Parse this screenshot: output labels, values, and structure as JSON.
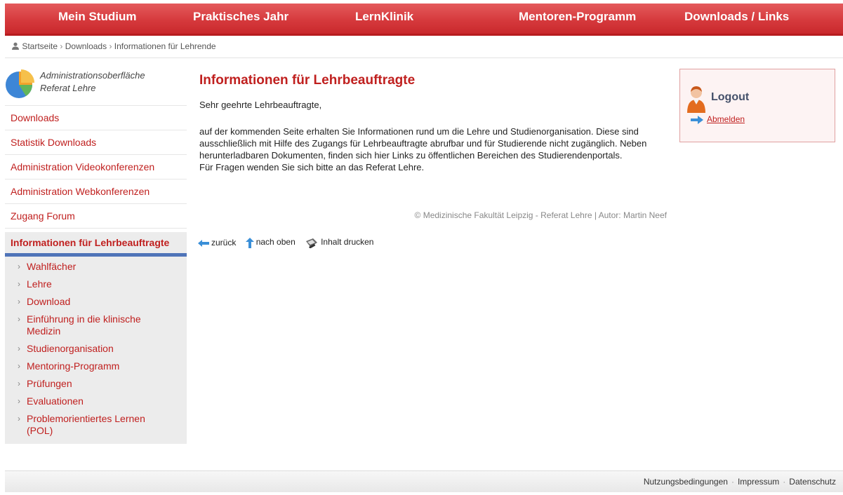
{
  "nav": {
    "items": [
      "Mein Studium",
      "Praktisches Jahr",
      "LernKlinik",
      "Mentoren-Programm",
      "Downloads / Links"
    ]
  },
  "breadcrumb": {
    "items": [
      "Startseite",
      "Downloads",
      "Informationen für Lehrende"
    ]
  },
  "sidebar": {
    "admin_line1": "Administrationsoberfläche",
    "admin_line2": "Referat Lehre",
    "links": [
      "Downloads",
      "Statistik Downloads",
      "Administration Videokonferenzen",
      "Administration Webkonferenzen",
      "Zugang Forum"
    ],
    "active": "Informationen für Lehrbeauftragte",
    "subitems": [
      "Wahlfächer",
      "Lehre",
      "Download",
      "Einführung in die klinische Medizin",
      "Studienorganisation",
      "Mentoring-Programm",
      "Prüfungen",
      "Evaluationen",
      "Problemorientiertes Lernen (POL)"
    ]
  },
  "main": {
    "title": "Informationen für Lehrbeauftragte",
    "greeting": "Sehr geehrte Lehrbeauftragte,",
    "paragraph": "auf der kommenden Seite erhalten Sie Informationen rund um die Lehre und Studienorganisation. Diese sind ausschließlich mit Hilfe des Zugangs für Lehrbeauftragte abrufbar und für Studierende nicht zugänglich. Neben herunterladbaren Dokumenten, finden sich hier Links zu öffentlichen Bereichen des Studierendenportals.",
    "question": "Für Fragen wenden Sie sich bitte an das Referat Lehre.",
    "copyright": "© Medizinische Fakultät Leipzig - Referat Lehre | Autor: Martin Neef"
  },
  "actions": {
    "back": "zurück",
    "top": "nach oben",
    "print": "Inhalt drucken"
  },
  "logout": {
    "title": "Logout",
    "link": "Abmelden"
  },
  "footer": {
    "terms": "Nutzungsbedingungen",
    "imprint": "Impressum",
    "privacy": "Datenschutz"
  },
  "colors": {
    "brand_red": "#c0201f",
    "nav_red": "#d63a3d",
    "active_underline": "#4f74b8"
  },
  "icons": [
    "user-icon",
    "pie-chart-icon",
    "arrow-left-icon",
    "arrow-up-icon",
    "printer-icon",
    "avatar-icon",
    "arrow-right-icon"
  ]
}
